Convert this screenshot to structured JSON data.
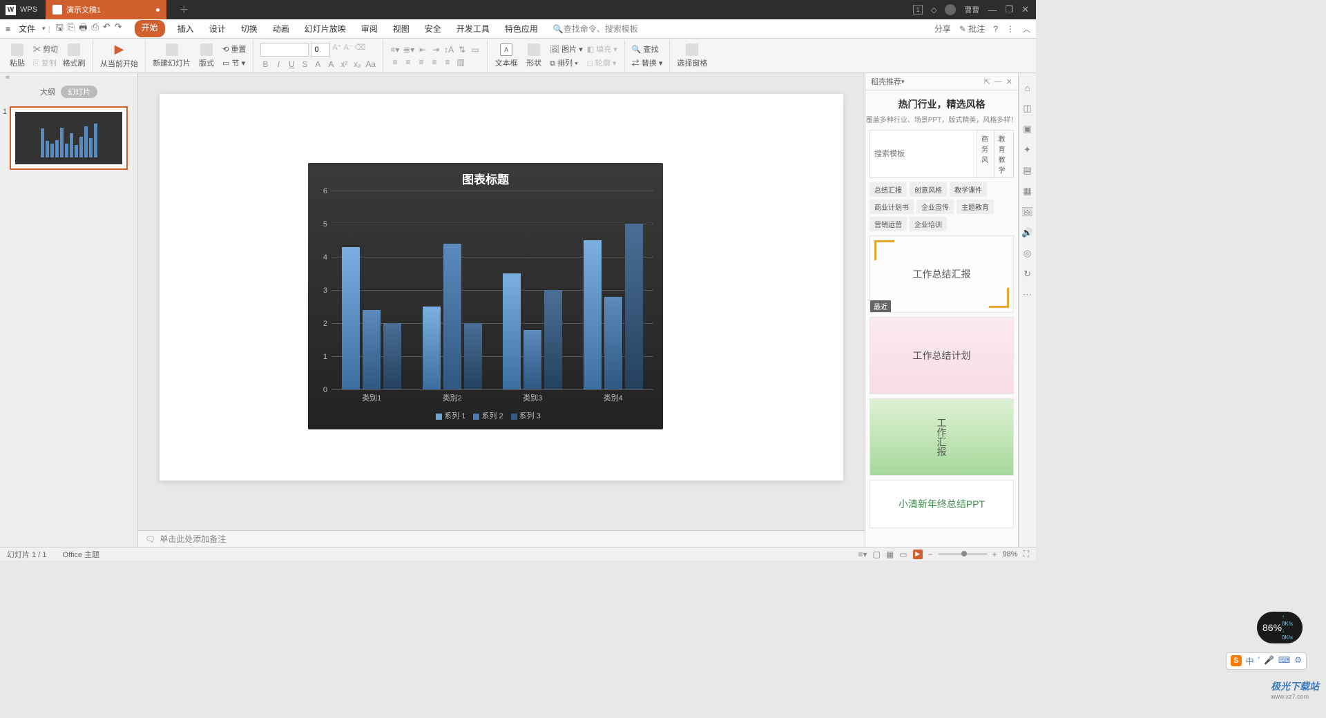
{
  "title_bar": {
    "app": "WPS",
    "tab_name": "演示文稿1",
    "badge": "1",
    "user": "曹曹"
  },
  "menu": {
    "file": "文件",
    "tabs": [
      "开始",
      "插入",
      "设计",
      "切换",
      "动画",
      "幻灯片放映",
      "审阅",
      "视图",
      "安全",
      "开发工具",
      "特色应用"
    ],
    "active_tab": 0,
    "search_placeholder": "查找命令、搜索模板",
    "share": "分享",
    "annotate": "批注"
  },
  "toolbar": {
    "paste": "粘贴",
    "cut": "剪切",
    "copy": "复制",
    "format_painter": "格式刷",
    "from_current": "从当前开始",
    "new_slide": "新建幻灯片",
    "layout": "版式",
    "reset": "重置",
    "section": "节",
    "font_name": "",
    "font_size": "0",
    "textbox": "文本框",
    "shape": "形状",
    "arrange": "排列",
    "align": "对齐",
    "picture": "图片",
    "fill": "填充",
    "outline": "轮廓",
    "find": "查找",
    "replace": "替换",
    "select_pane": "选择窗格"
  },
  "side": {
    "outline": "大纲",
    "slides": "幻灯片",
    "slide_num": "1"
  },
  "chart_data": {
    "type": "bar",
    "title": "图表标题",
    "categories": [
      "类别1",
      "类别2",
      "类别3",
      "类别4"
    ],
    "series": [
      {
        "name": "系列 1",
        "values": [
          4.3,
          2.5,
          3.5,
          4.5
        ]
      },
      {
        "name": "系列 2",
        "values": [
          2.4,
          4.4,
          1.8,
          2.8
        ]
      },
      {
        "name": "系列 3",
        "values": [
          2.0,
          2.0,
          3.0,
          5.0
        ]
      }
    ],
    "y_ticks": [
      0,
      1,
      2,
      3,
      4,
      5,
      6
    ],
    "ylim": [
      0,
      6
    ]
  },
  "notes": {
    "placeholder": "单击此处添加备注"
  },
  "right_panel": {
    "header": "稻壳推荐",
    "title": "热门行业，精选风格",
    "subtitle": "覆盖多种行业、场景PPT，版式精美，风格多样！",
    "search_placeholder": "搜索模板",
    "hot1": "商务风",
    "hot2": "教育教学",
    "tags": [
      "总结汇报",
      "创意风格",
      "教学课件",
      "商业计划书",
      "企业宣传",
      "主题教育",
      "营销运营",
      "企业培训"
    ],
    "recent": "最近",
    "templates": [
      "工作总结汇报",
      "工作总结计划",
      "工作汇报",
      "小清新年终总结PPT"
    ]
  },
  "status": {
    "slide_info": "幻灯片 1 / 1",
    "theme": "Office 主题",
    "zoom": "98%"
  },
  "speed": {
    "pct": "86%",
    "up": "0K/s",
    "down": "0K/s"
  },
  "ime": {
    "lang": "中"
  },
  "watermark": {
    "name": "极光下载站",
    "url": "www.xz7.com"
  }
}
